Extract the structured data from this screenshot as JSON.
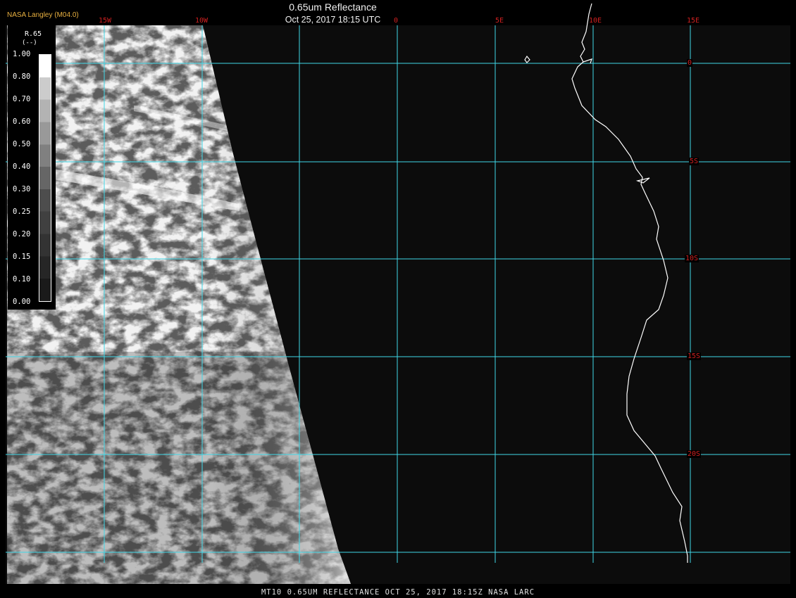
{
  "header": {
    "credit": "NASA Langley (M04.0)",
    "title": "0.65um Reflectance",
    "datetime": "Oct 25, 2017 18:15 UTC"
  },
  "footer": {
    "caption": "MT10  0.65UM REFLECTANCE   OCT 25, 2017 18:15Z   NASA LARC"
  },
  "legend": {
    "variable": "R.65",
    "unit": "(--)",
    "labels": [
      "1.00",
      "0.80",
      "0.70",
      "0.60",
      "0.50",
      "0.40",
      "0.30",
      "0.25",
      "0.20",
      "0.15",
      "0.10",
      "0.00"
    ]
  },
  "grid": {
    "longitudes": [
      "15W",
      "10W",
      "0",
      "5E",
      "10E",
      "15E"
    ],
    "latitudes": [
      "0",
      "5S",
      "10S",
      "15S",
      "20S"
    ]
  },
  "colors": {
    "grid": "#40d8e8",
    "grid_label": "#d02020",
    "coastline": "#ffffff",
    "ocean": "#0c0c0c",
    "credit": "#e8b040"
  }
}
